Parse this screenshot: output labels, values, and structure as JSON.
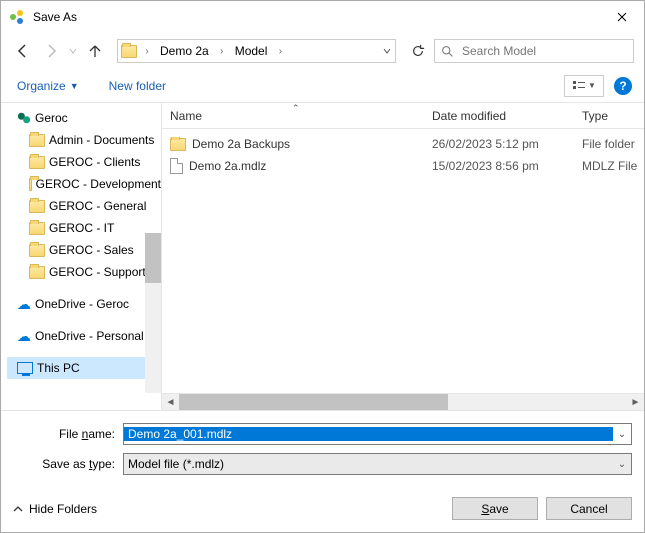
{
  "window": {
    "title": "Save As"
  },
  "breadcrumb": {
    "segments": [
      "Demo 2a",
      "Model"
    ]
  },
  "search": {
    "placeholder": "Search Model"
  },
  "toolbar": {
    "organize": "Organize",
    "newfolder": "New folder"
  },
  "columns": {
    "name": "Name",
    "date": "Date modified",
    "type": "Type"
  },
  "tree": {
    "root": "Geroc",
    "children": [
      "Admin - Documents",
      "GEROC - Clients",
      "GEROC - Development",
      "GEROC - General",
      "GEROC - IT",
      "GEROC - Sales",
      "GEROC - Support"
    ],
    "onedrive1": "OneDrive - Geroc",
    "onedrive2": "OneDrive - Personal",
    "thispc": "This PC"
  },
  "files": [
    {
      "name": "Demo 2a Backups",
      "date": "26/02/2023 5:12 pm",
      "type": "File folder",
      "kind": "folder"
    },
    {
      "name": "Demo 2a.mdlz",
      "date": "15/02/2023 8:56 pm",
      "type": "MDLZ File",
      "kind": "file"
    }
  ],
  "form": {
    "filename_label": "File name:",
    "filename_value": "Demo 2a_001.mdlz",
    "saveastype_label": "Save as type:",
    "saveastype_value": "Model file (*.mdlz)"
  },
  "buttons": {
    "hide_folders": "Hide Folders",
    "save": "Save",
    "cancel": "Cancel"
  }
}
